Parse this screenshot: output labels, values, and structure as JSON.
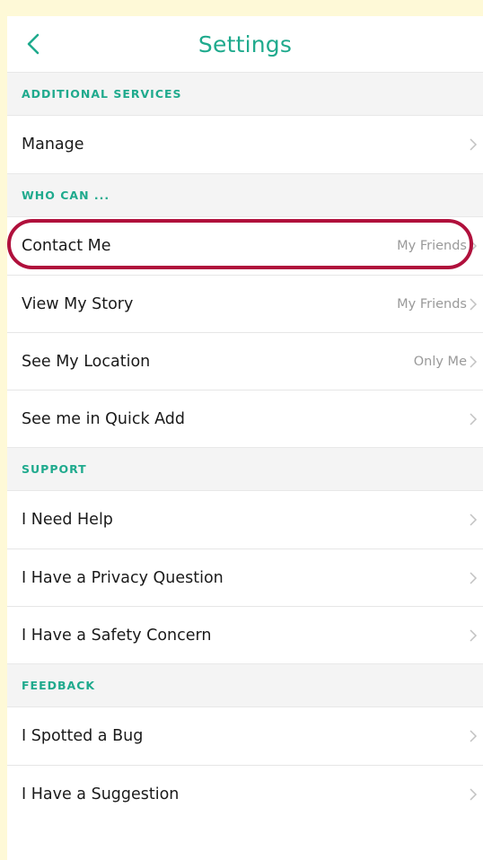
{
  "header": {
    "title": "Settings",
    "back_icon": "chevron-left-icon"
  },
  "sections": {
    "additional": {
      "title": "ADDITIONAL SERVICES",
      "manage": {
        "label": "Manage"
      }
    },
    "who_can": {
      "title": "WHO CAN ...",
      "contact_me": {
        "label": "Contact Me",
        "value": "My Friends"
      },
      "view_story": {
        "label": "View My Story",
        "value": "My Friends"
      },
      "see_location": {
        "label": "See My Location",
        "value": "Only Me"
      },
      "quick_add": {
        "label": "See me in Quick Add"
      }
    },
    "support": {
      "title": "SUPPORT",
      "need_help": {
        "label": "I Need Help"
      },
      "privacy": {
        "label": "I Have a Privacy Question"
      },
      "safety": {
        "label": "I Have a Safety Concern"
      }
    },
    "feedback": {
      "title": "FEEDBACK",
      "bug": {
        "label": "I Spotted a Bug"
      },
      "suggestion": {
        "label": "I Have a Suggestion"
      }
    }
  },
  "colors": {
    "accent": "#1faa8d",
    "highlight": "#b0103c",
    "page_background": "#fef9d7",
    "section_background": "#f4f4f4"
  }
}
